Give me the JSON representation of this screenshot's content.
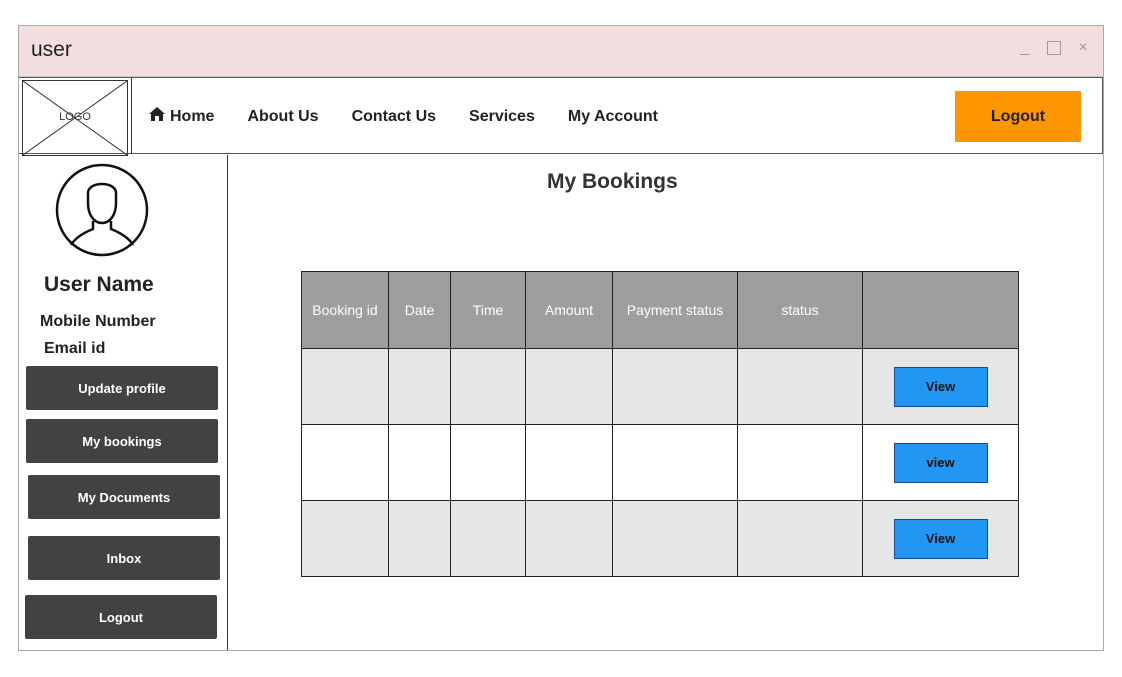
{
  "window": {
    "title": "user",
    "controls": {
      "minimize": "_",
      "maximize": "□",
      "close": "×"
    }
  },
  "header": {
    "logo_text": "LOGO",
    "nav": [
      {
        "label": "Home",
        "icon": "home-icon"
      },
      {
        "label": "About Us"
      },
      {
        "label": "Contact Us"
      },
      {
        "label": "Services"
      },
      {
        "label": "My Account"
      }
    ],
    "logout_label": "Logout",
    "logout_color": "#ff9500"
  },
  "sidebar": {
    "avatar_icon": "user-avatar-icon",
    "user_name": "User Name",
    "mobile": "Mobile Number",
    "email": "Email id",
    "buttons": [
      {
        "label": "Update profile"
      },
      {
        "label": "My bookings"
      },
      {
        "label": "My Documents"
      },
      {
        "label": "Inbox"
      },
      {
        "label": "Logout"
      }
    ]
  },
  "main": {
    "title": "My Bookings",
    "table": {
      "columns": [
        "Booking id",
        "Date",
        "Time",
        "Amount",
        "Payment status",
        "status",
        ""
      ],
      "rows": [
        {
          "cells": [
            "",
            "",
            "",
            "",
            "",
            ""
          ],
          "action": "View"
        },
        {
          "cells": [
            "",
            "",
            "",
            "",
            "",
            ""
          ],
          "action": "view"
        },
        {
          "cells": [
            "",
            "",
            "",
            "",
            "",
            ""
          ],
          "action": "View"
        }
      ]
    },
    "view_button_color": "#2196f3"
  }
}
